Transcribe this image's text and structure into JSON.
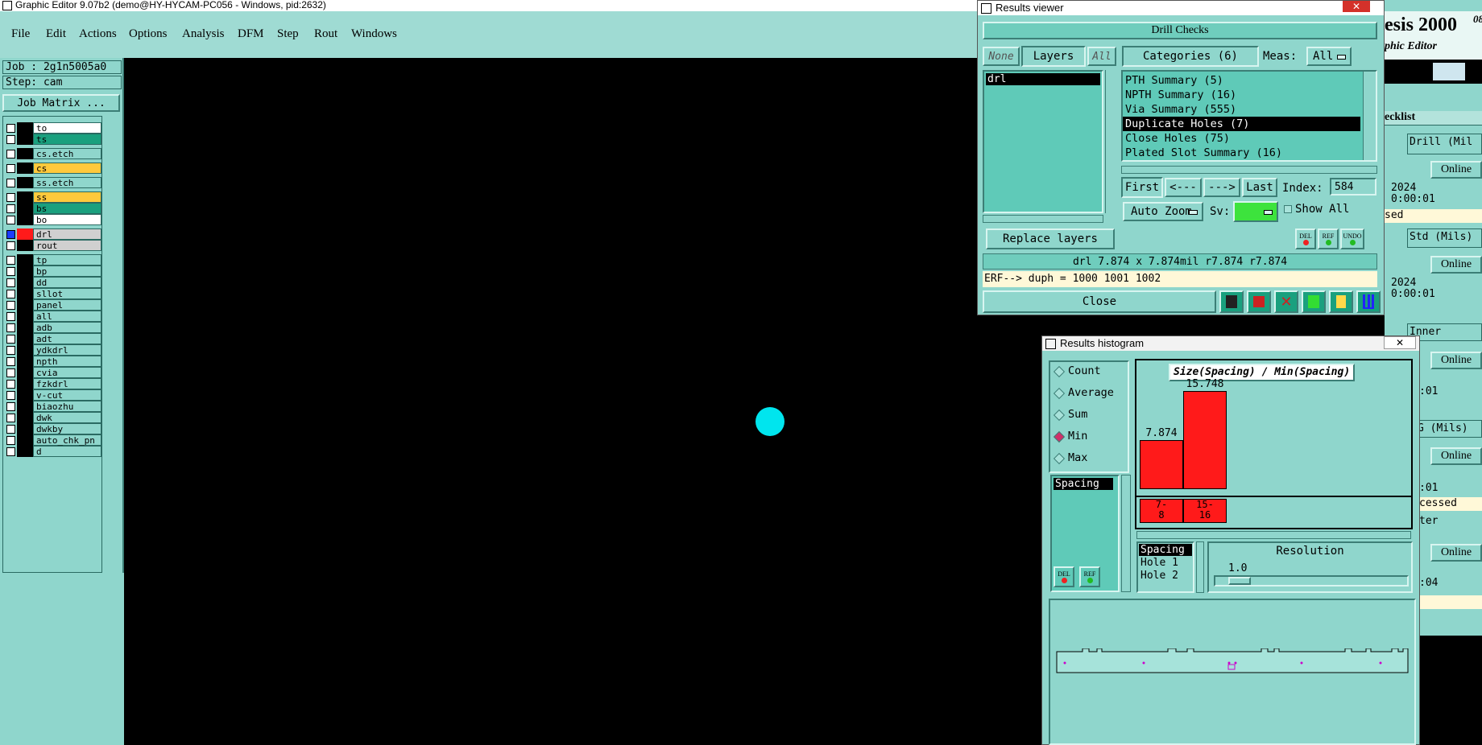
{
  "window": {
    "title": "Graphic Editor 9.07b2 (demo@HY-HYCAM-PC056 - Windows, pid:2632)"
  },
  "menu": [
    "File",
    "Edit",
    "Actions",
    "Options",
    "Analysis",
    "DFM",
    "Step",
    "Rout",
    "Windows"
  ],
  "job": {
    "job_label": "Job : 2g1n5005a0",
    "step_label": "Step: cam",
    "job_matrix": "Job Matrix ..."
  },
  "layers": [
    {
      "name": "to",
      "color": "#ffffff"
    },
    {
      "name": "ts",
      "color": "#1aa07e"
    },
    {
      "name": "cs.etch",
      "color": "#8fd6cc"
    },
    {
      "name": "cs",
      "color": "#ffc93c"
    },
    {
      "name": "ss.etch",
      "color": "#8fd6cc"
    },
    {
      "name": "ss",
      "color": "#ffc93c"
    },
    {
      "name": "bs",
      "color": "#1aa07e"
    },
    {
      "name": "bo",
      "color": "#ffffff"
    },
    {
      "name": "drl",
      "color": "#d0d0d0"
    },
    {
      "name": "rout",
      "color": "#d0d0d0"
    },
    {
      "name": "tp",
      "color": "#8fd6cc"
    },
    {
      "name": "bp",
      "color": "#8fd6cc"
    },
    {
      "name": "dd",
      "color": "#8fd6cc"
    },
    {
      "name": "sllot",
      "color": "#8fd6cc"
    },
    {
      "name": "panel",
      "color": "#8fd6cc"
    },
    {
      "name": "all",
      "color": "#8fd6cc"
    },
    {
      "name": "adb",
      "color": "#8fd6cc"
    },
    {
      "name": "adt",
      "color": "#8fd6cc"
    },
    {
      "name": "ydkdrl",
      "color": "#8fd6cc"
    },
    {
      "name": "npth",
      "color": "#8fd6cc"
    },
    {
      "name": "cvia",
      "color": "#8fd6cc"
    },
    {
      "name": "fzkdrl",
      "color": "#8fd6cc"
    },
    {
      "name": "v-cut",
      "color": "#8fd6cc"
    },
    {
      "name": "biaozhu",
      "color": "#8fd6cc"
    },
    {
      "name": "dwk",
      "color": "#8fd6cc"
    },
    {
      "name": "dwkby",
      "color": "#8fd6cc"
    },
    {
      "name": "auto_chk_pn",
      "color": "#8fd6cc"
    },
    {
      "name": "d",
      "color": "#8fd6cc"
    }
  ],
  "results_viewer": {
    "title": "Results viewer",
    "section": "Drill Checks",
    "none_btn": "None",
    "layers_btn": "Layers",
    "all_btn": "All",
    "categories_btn": "Categories (6)",
    "meas_label": "Meas:",
    "meas_value": "All",
    "layer_list": [
      "drl"
    ],
    "categories": [
      "PTH Summary (5)",
      "NPTH Summary (16)",
      "Via Summary (555)",
      "Duplicate Holes (7)",
      "Close Holes (75)",
      "Plated Slot Summary (16)"
    ],
    "selected_category": "Duplicate Holes (7)",
    "first": "First",
    "prev": "<---",
    "next": "--->",
    "last": "Last",
    "index_label": "Index:",
    "index_value": "584",
    "auto_zoom": "Auto Zoom",
    "sv_label": "Sv:",
    "show_all": "Show All",
    "replace_layers": "Replace layers",
    "del": "DEL",
    "ref": "REF",
    "undo": "UNDO",
    "status": "drl 7.874 x 7.874mil  r7.874  r7.874",
    "erf": "ERF--> duph = 1000 1001 1002",
    "close": "Close"
  },
  "histogram": {
    "title": "Results histogram",
    "modes": [
      "Count",
      "Average",
      "Sum",
      "Min",
      "Max"
    ],
    "selected_mode": "Min",
    "field_list": [
      "Spacing"
    ],
    "chart_title": "Size(Spacing) / Min(Spacing)",
    "bars": [
      {
        "label": "7.874",
        "bin_top": "7-",
        "bin_bottom": "8",
        "value": 7.874
      },
      {
        "label": "15.748",
        "bin_top": "15-",
        "bin_bottom": "16",
        "value": 15.748
      }
    ],
    "sort_list": [
      "Spacing",
      "Hole 1",
      "Hole 2"
    ],
    "resolution_label": "Resolution",
    "resolution_value": "1.0",
    "del": "DEL",
    "ref": "REF"
  },
  "right_partial": {
    "title_fragment": "esis 2000",
    "superscript": "08",
    "subtitle": "phic Editor",
    "checklist": "ecklist",
    "rows": [
      "Drill (Mil",
      "Online",
      "2024",
      "0:00:01",
      "sed",
      "Std (Mils)",
      "Online",
      "2024",
      "0:00:01",
      "Inner",
      "Online",
      ":01",
      "G (Mils)",
      "Online",
      ":01",
      "cessed",
      "ter",
      "Online",
      ":04"
    ]
  }
}
